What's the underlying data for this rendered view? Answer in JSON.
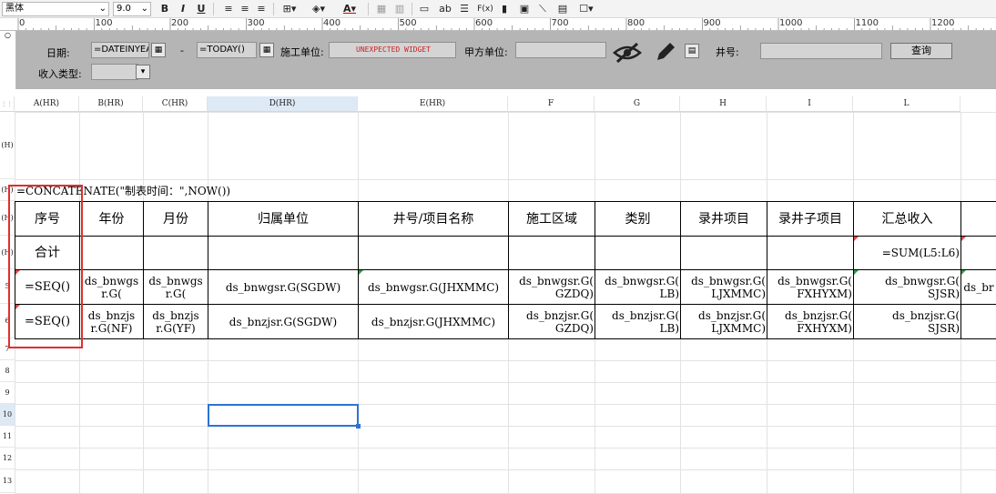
{
  "toolbar": {
    "font_name": "黑体",
    "font_size": "9.0",
    "bold": "B",
    "italic": "I",
    "underline": "U",
    "font_color_label": "A",
    "text_ab": "ab",
    "fx": "F(x)"
  },
  "ruler": {
    "marks": [
      "0",
      "100",
      "200",
      "300",
      "400",
      "500",
      "600",
      "700",
      "800",
      "900",
      "1000",
      "1100",
      "1200"
    ]
  },
  "params": {
    "date_label": "日期:",
    "date_start_value": "=DATEINYEA",
    "dash": "-",
    "date_end_value": "=TODAY()",
    "unit_label": "施工单位:",
    "unit_value": "UNEXPECTED WIDGET",
    "party_label": "甲方单位:",
    "party_value": "",
    "well_label": "井号:",
    "well_value": "",
    "query_button": "查询",
    "income_label": "收入类型:",
    "income_value": ""
  },
  "column_headers": [
    "A(HR)",
    "B(HR)",
    "C(HR)",
    "D(HR)",
    "E(HR)",
    "F",
    "G",
    "H",
    "I",
    "L"
  ],
  "row_headers": [
    "(H)",
    "(H)",
    "(H)",
    "(H)",
    "5",
    "6",
    "7",
    "8",
    "9",
    "10",
    "11",
    "12",
    "13"
  ],
  "sheet": {
    "formula_row": "=CONCATENATE(\"制表时间：\",NOW())",
    "header_row": [
      "序号",
      "年份",
      "月份",
      "归属单位",
      "井号/项目名称",
      "施工区域",
      "类别",
      "录井项目",
      "录井子项目",
      "汇总收入"
    ],
    "total_row": {
      "label": "合计",
      "sum_formula": "=SUM(L5:L6)"
    },
    "row5": [
      "=SEQ()",
      "ds_bnwgs\nr.G(",
      "ds_bnwgs\nr.G(",
      "ds_bnwgsr.G(SGDW)",
      "ds_bnwgsr.G(JHXMMC)",
      "ds_bnwgsr.G(\nGZDQ)",
      "ds_bnwgsr.G(\nLB)",
      "ds_bnwgsr.G(\nLJXMMC)",
      "ds_bnwgsr.G(\nFXHYXM)",
      "ds_bnwgsr.G(\nSJSR)",
      "ds_br"
    ],
    "row6": [
      "=SEQ()",
      "ds_bnzjs\nr.G(NF)",
      "ds_bnzjs\nr.G(YF)",
      "ds_bnzjsr.G(SGDW)",
      "ds_bnzjsr.G(JHXMMC)",
      "ds_bnzjsr.G(\nGZDQ)",
      "ds_bnzjsr.G(\nLB)",
      "ds_bnzjsr.G(\nLJXMMC)",
      "ds_bnzjsr.G(\nFXHYXM)",
      "ds_bnzjsr.G(\nSJSR)"
    ]
  },
  "colors": {
    "highlight": "#e32d2d",
    "selection": "#2b74d4",
    "param_bg": "#b5b5b5"
  }
}
